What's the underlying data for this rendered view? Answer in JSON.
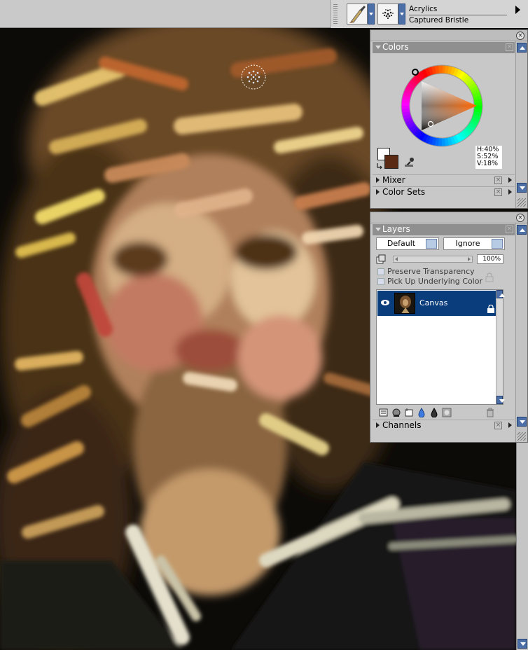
{
  "toolbar": {
    "brush_category": "Acrylics",
    "brush_variant": "Captured Bristle"
  },
  "colors_panel": {
    "title": "Colors",
    "hue": "H:40%",
    "sat": "S:52%",
    "val": "V:18%",
    "main_color": "#5a2a14",
    "secondary_color": "#ffffff"
  },
  "mixer_panel": {
    "title": "Mixer"
  },
  "color_sets_panel": {
    "title": "Color Sets"
  },
  "layers_panel": {
    "title": "Layers",
    "composite_method": "Default",
    "composite_depth": "Ignore",
    "opacity": "100%",
    "preserve_transparency": "Preserve Transparency",
    "pick_up_underlying": "Pick Up Underlying Color",
    "layers": [
      {
        "name": "Canvas"
      }
    ]
  },
  "channels_panel": {
    "title": "Channels"
  },
  "icons": [
    "paintbrush-icon",
    "dab-icon",
    "close-icon",
    "eye-icon",
    "lock-icon",
    "trash-icon",
    "new-layer-icon"
  ]
}
